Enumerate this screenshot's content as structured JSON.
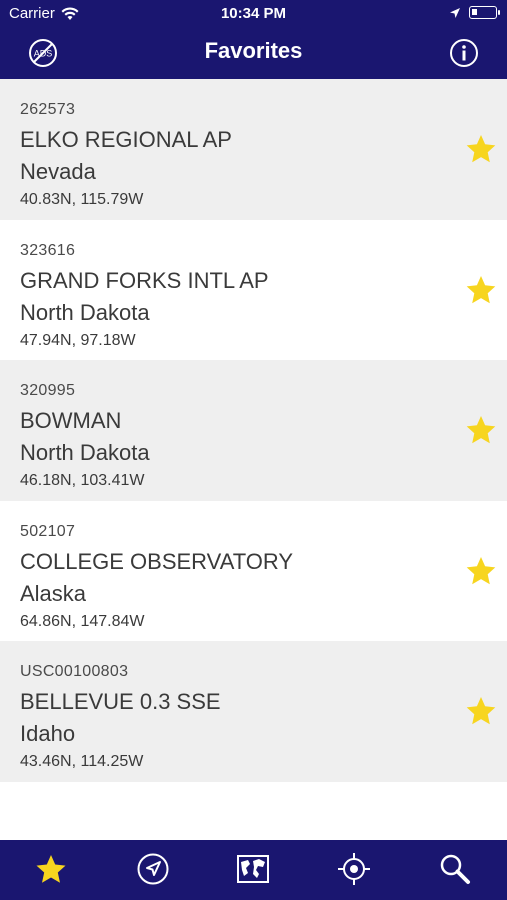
{
  "status": {
    "carrier": "Carrier",
    "time": "10:34 PM"
  },
  "navbar": {
    "title": "Favorites",
    "left_icon": "ads-off-icon",
    "right_icon": "info-icon"
  },
  "colors": {
    "bar": "#1a1670",
    "star": "#f7d51f",
    "row_shaded": "#efefef"
  },
  "favorites": [
    {
      "code": "262573",
      "name": "ELKO REGIONAL AP",
      "state": "Nevada",
      "coords": "40.83N, 115.79W"
    },
    {
      "code": "323616",
      "name": "GRAND FORKS INTL AP",
      "state": "North Dakota",
      "coords": "47.94N, 97.18W"
    },
    {
      "code": "320995",
      "name": "BOWMAN",
      "state": "North Dakota",
      "coords": "46.18N, 103.41W"
    },
    {
      "code": "502107",
      "name": "COLLEGE OBSERVATORY",
      "state": "Alaska",
      "coords": "64.86N, 147.84W"
    },
    {
      "code": "USC00100803",
      "name": "BELLEVUE 0.3 SSE",
      "state": "Idaho",
      "coords": "43.46N, 114.25W"
    }
  ],
  "tabbar": {
    "items": [
      "star-icon",
      "navigation-arrow-icon",
      "map-icon",
      "crosshair-icon",
      "search-icon"
    ],
    "active": "star-icon"
  }
}
